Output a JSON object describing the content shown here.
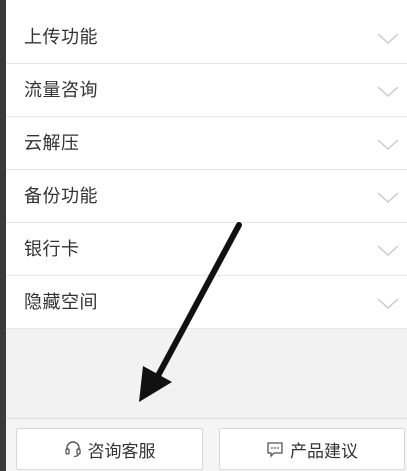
{
  "menu": {
    "items": [
      {
        "label": "上传功能"
      },
      {
        "label": "流量咨询"
      },
      {
        "label": "云解压"
      },
      {
        "label": "备份功能"
      },
      {
        "label": "银行卡"
      },
      {
        "label": "隐藏空间"
      }
    ]
  },
  "footer": {
    "customer_service_label": "咨询客服",
    "feedback_label": "产品建议"
  },
  "icons": {
    "expand": "chevron-down-icon",
    "customer_service": "headset-icon",
    "feedback": "chat-bubble-icon"
  },
  "colors": {
    "text": "#333333",
    "chevron": "#cccccc",
    "panel_bg": "#f2f2f2"
  }
}
